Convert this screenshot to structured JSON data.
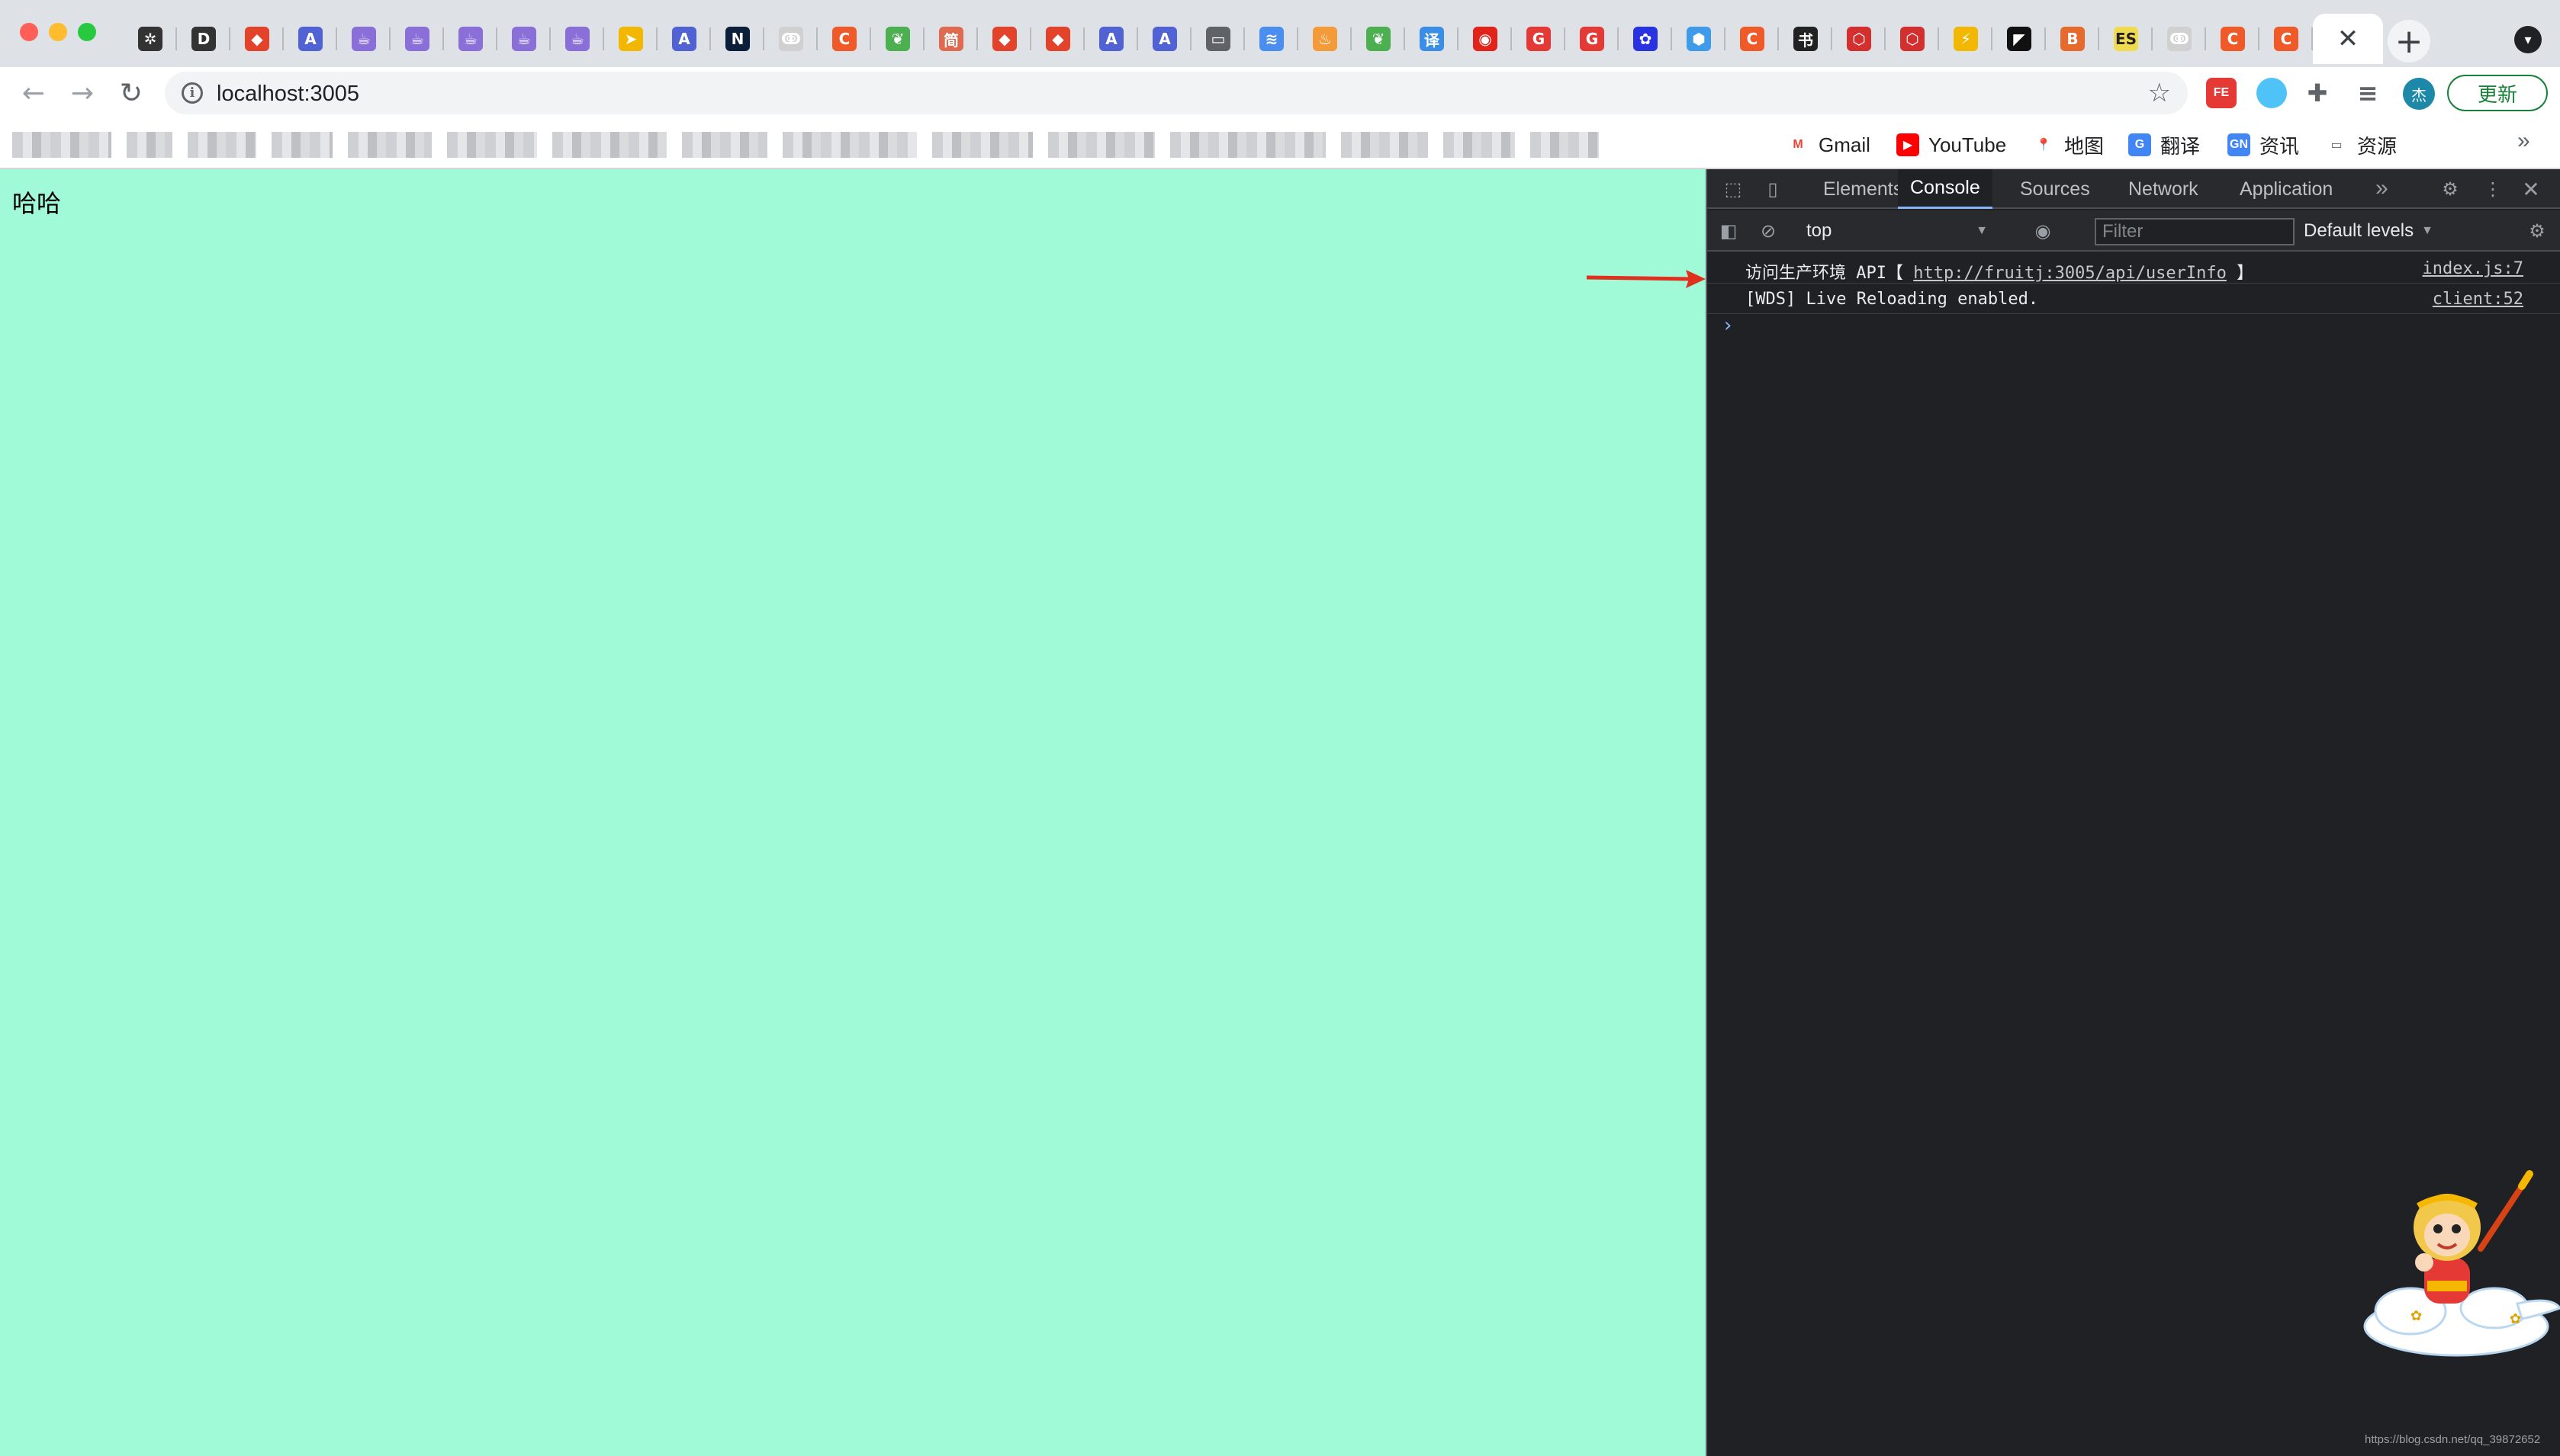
{
  "window": {
    "traffic_lights": [
      "close",
      "minimize",
      "maximize"
    ]
  },
  "tabs": [
    {
      "icon": "dev-icon",
      "glyph": "✲",
      "color": "#333333"
    },
    {
      "icon": "d-icon",
      "glyph": "D",
      "color": "#333333"
    },
    {
      "icon": "gitlab-icon",
      "glyph": "◆",
      "color": "#e2432a"
    },
    {
      "icon": "a-icon",
      "glyph": "A",
      "color": "#5062d4"
    },
    {
      "icon": "java-icon",
      "glyph": "☕",
      "color": "#8a6fd8"
    },
    {
      "icon": "java-icon",
      "glyph": "☕",
      "color": "#8a6fd8"
    },
    {
      "icon": "java-icon",
      "glyph": "☕",
      "color": "#8a6fd8"
    },
    {
      "icon": "java-icon",
      "glyph": "☕",
      "color": "#8a6fd8"
    },
    {
      "icon": "java-icon",
      "glyph": "☕",
      "color": "#8a6fd8"
    },
    {
      "icon": "yuque-icon",
      "glyph": "➤",
      "color": "#f2b700"
    },
    {
      "icon": "a-icon",
      "glyph": "A",
      "color": "#5062d4"
    },
    {
      "icon": "n-icon",
      "glyph": "N",
      "color": "#0b1f3a"
    },
    {
      "icon": "swirl-icon",
      "glyph": "ↂ",
      "color": "#d0d0d0"
    },
    {
      "icon": "c-icon",
      "glyph": "C",
      "color": "#f05a28"
    },
    {
      "icon": "leaf-icon",
      "glyph": "❦",
      "color": "#4caf50"
    },
    {
      "icon": "jian-icon",
      "glyph": "简",
      "color": "#e06a4f"
    },
    {
      "icon": "gitlab-icon",
      "glyph": "◆",
      "color": "#e2432a"
    },
    {
      "icon": "gitlab-icon",
      "glyph": "◆",
      "color": "#e2432a"
    },
    {
      "icon": "a-icon",
      "glyph": "A",
      "color": "#5062d4"
    },
    {
      "icon": "a-icon",
      "glyph": "A",
      "color": "#5062d4"
    },
    {
      "icon": "folder-icon",
      "glyph": "▭",
      "color": "#5f6368"
    },
    {
      "icon": "layers-icon",
      "glyph": "≋",
      "color": "#4a8ff0"
    },
    {
      "icon": "flame-icon",
      "glyph": "♨",
      "color": "#f29b38"
    },
    {
      "icon": "leaf-icon",
      "glyph": "❦",
      "color": "#4caf50"
    },
    {
      "icon": "translate-icon",
      "glyph": "译",
      "color": "#3a8ee6"
    },
    {
      "icon": "netease-icon",
      "glyph": "◉",
      "color": "#e2231a"
    },
    {
      "icon": "g-icon",
      "glyph": "G",
      "color": "#e53935"
    },
    {
      "icon": "g-icon",
      "glyph": "G",
      "color": "#e53935"
    },
    {
      "icon": "baidu-icon",
      "glyph": "✿",
      "color": "#2932e1"
    },
    {
      "icon": "hex-icon",
      "glyph": "⬢",
      "color": "#3d9be9"
    },
    {
      "icon": "c-icon",
      "glyph": "C",
      "color": "#f05a28"
    },
    {
      "icon": "calligraphy-icon",
      "glyph": "书",
      "color": "#222222"
    },
    {
      "icon": "cube-icon",
      "glyph": "⬡",
      "color": "#d32f2f"
    },
    {
      "icon": "cube-icon",
      "glyph": "⬡",
      "color": "#d32f2f"
    },
    {
      "icon": "bolt-icon",
      "glyph": "⚡",
      "color": "#f2b700"
    },
    {
      "icon": "black-icon",
      "glyph": "◤",
      "color": "#111111"
    },
    {
      "icon": "b-icon",
      "glyph": "B",
      "color": "#e66a2c"
    },
    {
      "icon": "es-icon",
      "glyph": "ES",
      "color": "#f0db4f"
    },
    {
      "icon": "swirl-icon",
      "glyph": "ↂ",
      "color": "#d0d0d0"
    },
    {
      "icon": "c-icon",
      "glyph": "C",
      "color": "#f05a28"
    },
    {
      "icon": "c-icon",
      "glyph": "C",
      "color": "#f05a28"
    }
  ],
  "active_tab": {
    "close_glyph": "✕"
  },
  "toolbar": {
    "back_glyph": "←",
    "forward_glyph": "→",
    "reload_glyph": "↻",
    "url": "localhost:3005",
    "info_glyph": "i",
    "star_glyph": "☆",
    "ext_fe": "FE",
    "puzzle_glyph": "✚",
    "readlist_glyph": "≡",
    "avatar": "杰",
    "update_label": "更新",
    "new_tab_glyph": "+",
    "tab_search_glyph": "▾"
  },
  "bookmarks": {
    "items": [
      {
        "label": "Gmail",
        "icon_glyph": "M",
        "icon_color": "#ffffff",
        "icon_text": "#ea4335"
      },
      {
        "label": "YouTube",
        "icon_glyph": "▶",
        "icon_color": "#ff0000",
        "icon_text": "#ffffff"
      },
      {
        "label": "地图",
        "icon_glyph": "📍",
        "icon_color": "#ffffff",
        "icon_text": "#34a853"
      },
      {
        "label": "翻译",
        "icon_glyph": "G",
        "icon_color": "#4285f4",
        "icon_text": "#ffffff"
      },
      {
        "label": "资讯",
        "icon_glyph": "GN",
        "icon_color": "#4285f4",
        "icon_text": "#ffffff"
      },
      {
        "label": "资源",
        "icon_glyph": "▭",
        "icon_color": "#ffffff",
        "icon_text": "#5f6368"
      }
    ],
    "more_glyph": "»"
  },
  "page": {
    "text": "哈哈",
    "background": "#a0fad8"
  },
  "devtools": {
    "tabs": [
      "Elements",
      "Console",
      "Sources",
      "Network",
      "Application"
    ],
    "active_tab": "Console",
    "more_tabs_glyph": "»",
    "gear_glyph": "⚙",
    "kebab_glyph": "⋮",
    "close_glyph": "✕",
    "inspect_glyph": "⬚",
    "device_glyph": "▯",
    "sidebar_glyph": "◧",
    "clear_glyph": "⊘",
    "eye_glyph": "◉",
    "context": "top",
    "context_arrow": "▼",
    "filter_placeholder": "Filter",
    "levels": "Default levels",
    "levels_arrow": "▼",
    "logs": [
      {
        "prefix": "访问生产环境 API【 ",
        "link": "http://fruitj:3005/api/userInfo",
        "suffix": " 】",
        "source": "index.js:7"
      },
      {
        "prefix": "[WDS] Live Reloading enabled.",
        "link": "",
        "suffix": "",
        "source": "client:52"
      }
    ],
    "prompt_glyph": "›"
  },
  "watermark": "https://blog.csdn.net/qq_39872652"
}
